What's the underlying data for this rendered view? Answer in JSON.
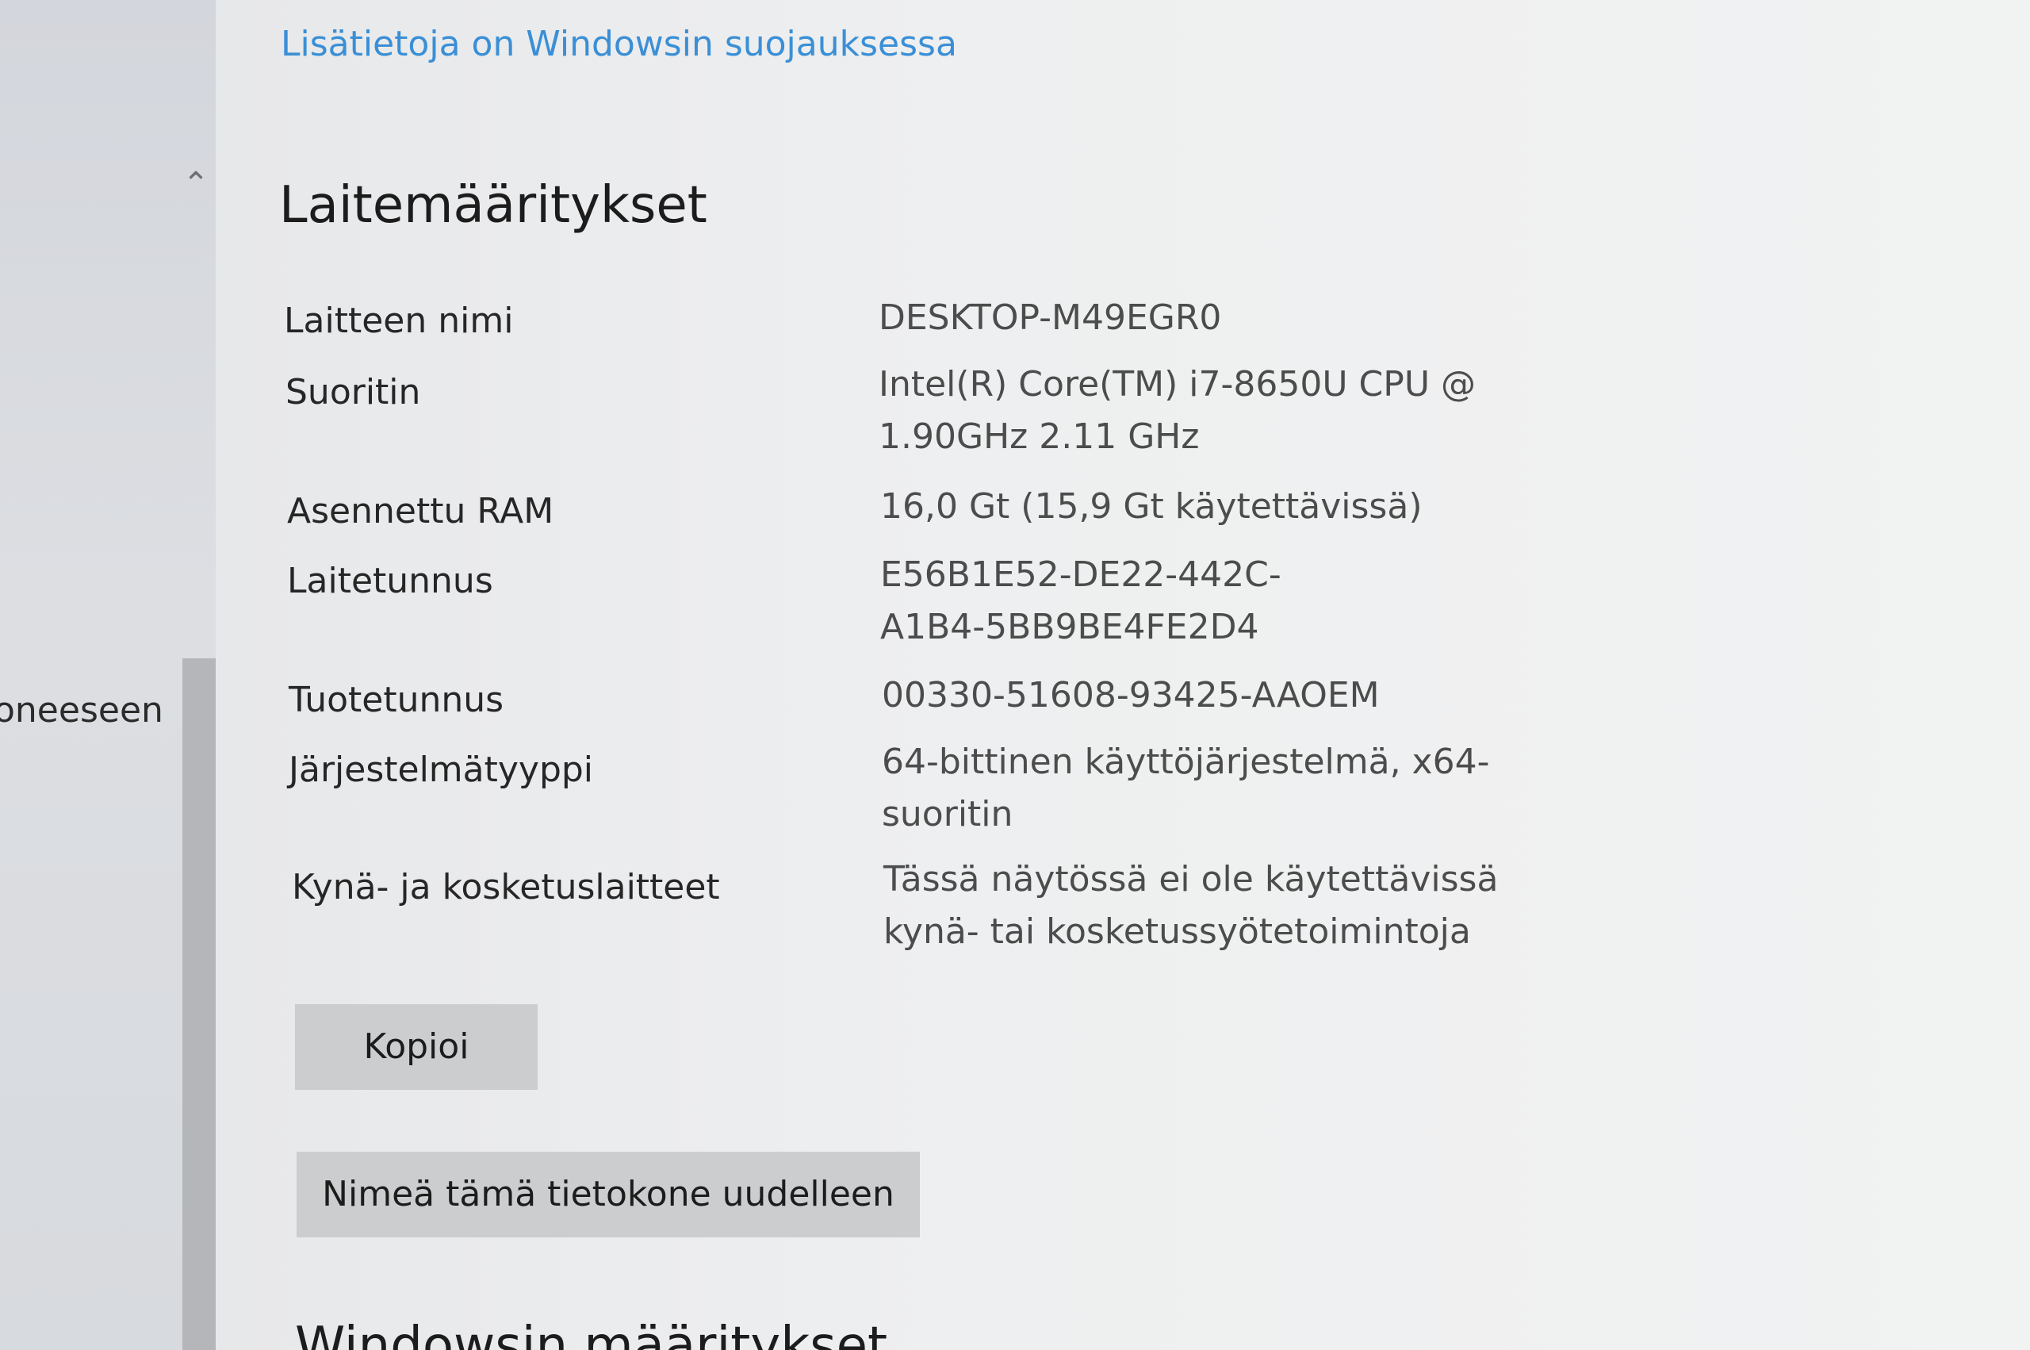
{
  "nav": {
    "partial_item": "oneeseen"
  },
  "header": {
    "security_link": "Lisätietoja on Windowsin suojauksessa"
  },
  "device_specs": {
    "title": "Laitemääritykset",
    "rows": [
      {
        "label": "Laitteen nimi",
        "value": "DESKTOP-M49EGR0"
      },
      {
        "label": "Suoritin",
        "value": "Intel(R) Core(TM) i7-8650U CPU @ 1.90GHz   2.11 GHz"
      },
      {
        "label": "Asennettu RAM",
        "value": "16,0 Gt (15,9 Gt käytettävissä)"
      },
      {
        "label": "Laitetunnus",
        "value": "E56B1E52-DE22-442C-A1B4-5BB9BE4FE2D4"
      },
      {
        "label": "Tuotetunnus",
        "value": "00330-51608-93425-AAOEM"
      },
      {
        "label": "Järjestelmätyyppi",
        "value": "64-bittinen käyttöjärjestelmä, x64-suoritin"
      },
      {
        "label": "Kynä- ja kosketuslaitteet",
        "value": "Tässä näytössä ei ole käytettävissä kynä- tai kosketussyötetoimintoja"
      }
    ],
    "copy_button": "Kopioi",
    "rename_button": "Nimeä tämä tietokone uudelleen"
  },
  "next_section": {
    "title": "Windowsin määritykset"
  }
}
